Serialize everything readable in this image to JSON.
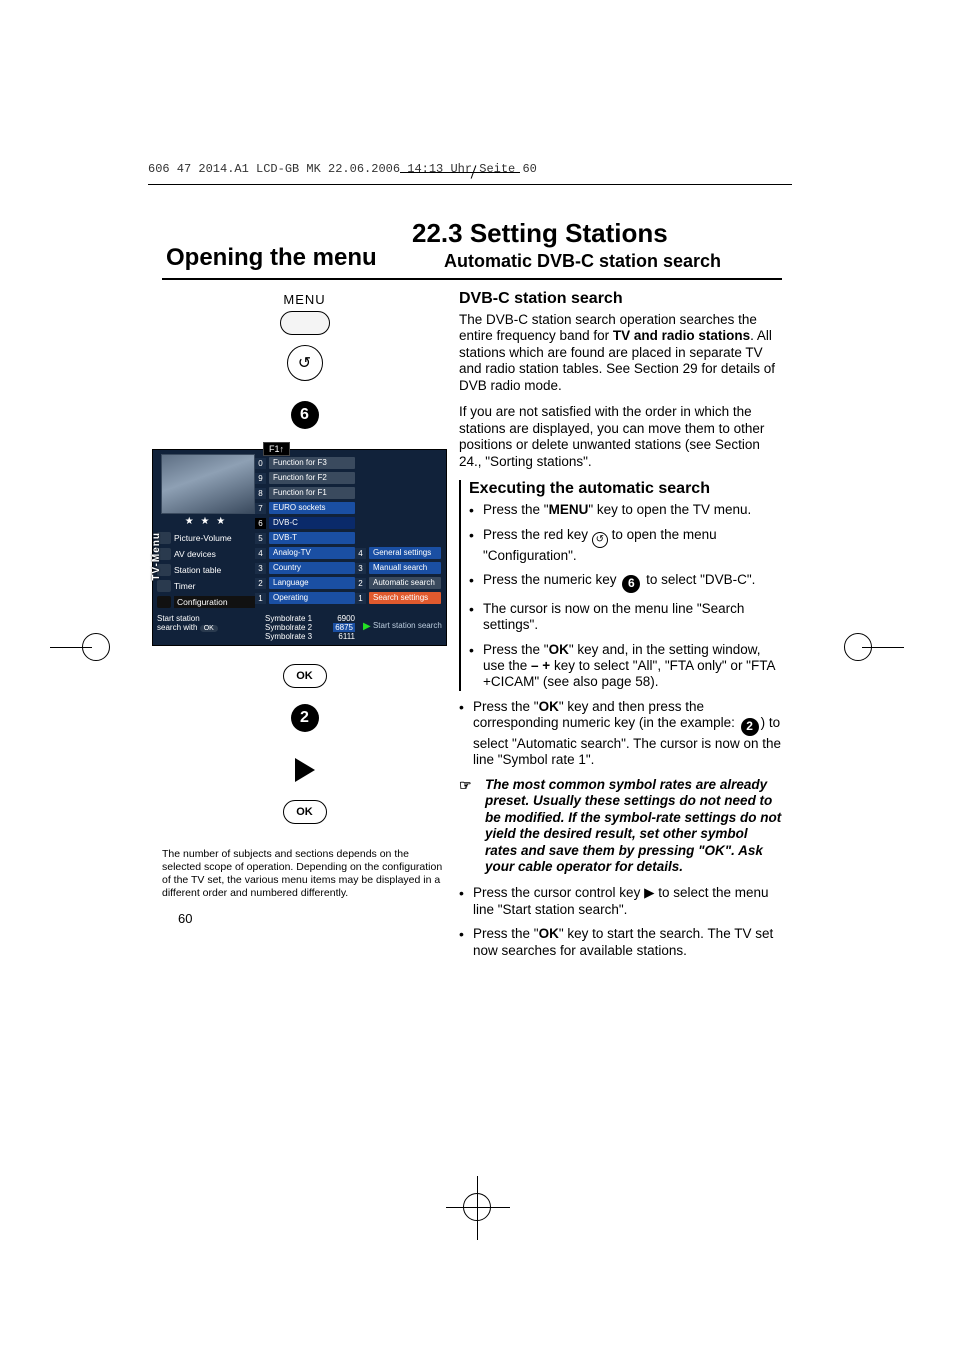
{
  "header_line": "606 47 2014.A1 LCD-GB MK  22.06.2006  14:13 Uhr  Seite 60",
  "title_left": "Opening the menu",
  "title_right_main": "22.3 Setting Stations",
  "title_right_sub": "Automatic DVB-C station search",
  "remote": {
    "menu_label": "MENU",
    "num6": "6",
    "ok": "OK",
    "num2": "2",
    "back_glyph": "↺"
  },
  "tv_menu": {
    "f1": "F1↑",
    "side_label": "TV-Menu",
    "left": [
      "Picture-Volume",
      "AV devices",
      "Station table",
      "Timer",
      "Configuration"
    ],
    "mid": [
      {
        "n": "0",
        "l": "Function for F3"
      },
      {
        "n": "9",
        "l": "Function for F2"
      },
      {
        "n": "8",
        "l": "Function for F1"
      },
      {
        "n": "7",
        "l": "EURO sockets"
      },
      {
        "n": "6",
        "l": "DVB-C"
      },
      {
        "n": "5",
        "l": "DVB-T"
      },
      {
        "n": "4",
        "l": "Analog-TV"
      },
      {
        "n": "3",
        "l": "Country"
      },
      {
        "n": "2",
        "l": "Language"
      },
      {
        "n": "1",
        "l": "Operating"
      }
    ],
    "right": [
      {
        "n": "4",
        "l": "General settings"
      },
      {
        "n": "3",
        "l": "Manuall search"
      },
      {
        "n": "2",
        "l": "Automatic search"
      },
      {
        "n": "1",
        "l": "Search settings"
      }
    ],
    "hint_l1": "Start station",
    "hint_l2": "search with",
    "hint_ok": "OK",
    "rates": [
      {
        "k": "Symbolrate 1",
        "v": "6900"
      },
      {
        "k": "Symbolrate 2",
        "v": "6875"
      },
      {
        "k": "Symbolrate 3",
        "v": "6111"
      }
    ],
    "start": "Start station search"
  },
  "footnote": "The number of subjects and sections depends on the selected scope of operation. Depending on the configuration of the TV set, the various menu items may be displayed in a different order and numbered differently.",
  "page_num": "60",
  "right": {
    "h1": "DVB-C station search",
    "p1a": "The DVB-C station search operation searches the entire frequency band for ",
    "p1b": "TV and radio stations",
    "p1c": ". All stations which are found are placed in separate TV and radio station tables. See Section 29 for details of DVB radio mode.",
    "p2": "If you are not satisfied with the order in which the stations are displayed, you can move them to other positions or delete unwanted stations (see Section 24., \"Sorting stations\".",
    "h2": "Executing the automatic search",
    "b1a": "Press the \"",
    "b1b": "MENU",
    "b1c": "\" key to open the TV menu.",
    "b2a": "Press the red key ",
    "b2b": " to open the menu \"Configuration\".",
    "b3a": "Press the numeric key ",
    "b3b": " to select \"DVB-C\".",
    "b4": "The cursor is now on the menu line \"Search settings\".",
    "b5a": "Press the \"",
    "b5b": "OK",
    "b5c": "\" key and, in the setting window, use the ",
    "b5d": "– +",
    "b5e": " key to select \"All\", \"FTA only\" or \"FTA +CICAM\" (see also page 58).",
    "b6a": "Press the \"",
    "b6b": "OK",
    "b6c": "\" key and then press the corresponding numeric key (in the example: ",
    "b6d": ") to select \"Automatic search\". The cursor is now on the line \"Symbol rate 1\".",
    "tip": "The most common symbol rates are already preset. Usually these settings do not need to be modified. If the symbol-rate settings do not yield the desired result, set other symbol rates and save them by pressing \"OK\". Ask your cable operator for details.",
    "b7a": "Press the cursor control key ▶ to select the menu line \"Start station search\".",
    "b8a": "Press the \"",
    "b8b": "OK",
    "b8c": "\" key to start the search. The TV set now searches for available stations."
  }
}
